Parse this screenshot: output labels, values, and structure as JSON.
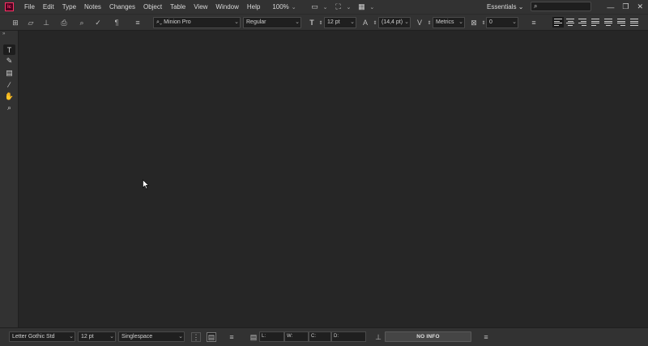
{
  "menubar": {
    "app_icon": "Ic",
    "items": [
      "File",
      "Edit",
      "Type",
      "Notes",
      "Changes",
      "Object",
      "Table",
      "View",
      "Window",
      "Help"
    ],
    "zoom": "100%",
    "workspace": "Essentials",
    "search_placeholder": "",
    "window_controls": [
      "minimize-icon",
      "restore-icon",
      "close-icon"
    ]
  },
  "control": {
    "font_family": "Minion Pro",
    "font_style": "Regular",
    "font_size": "12 pt",
    "leading": "(14,4 pt)",
    "kerning": "Metrics",
    "tracking": "0",
    "alignments": [
      "align-left",
      "align-center",
      "align-right",
      "justify-left",
      "justify-center",
      "justify-right",
      "justify-all"
    ]
  },
  "tools": [
    "type-tool",
    "note-tool",
    "position-tool",
    "eyedropper-tool",
    "hand-tool",
    "zoom-tool"
  ],
  "bottom": {
    "font_family": "Letter Gothic Std",
    "font_size": "12 pt",
    "spacing": "Singlespace",
    "stats": [
      "L:",
      "W:",
      "C:",
      "D:"
    ],
    "info_button": "NO INFO"
  },
  "colors": {
    "background": "#262626",
    "panel": "#323232",
    "accent": "#ff3366"
  }
}
